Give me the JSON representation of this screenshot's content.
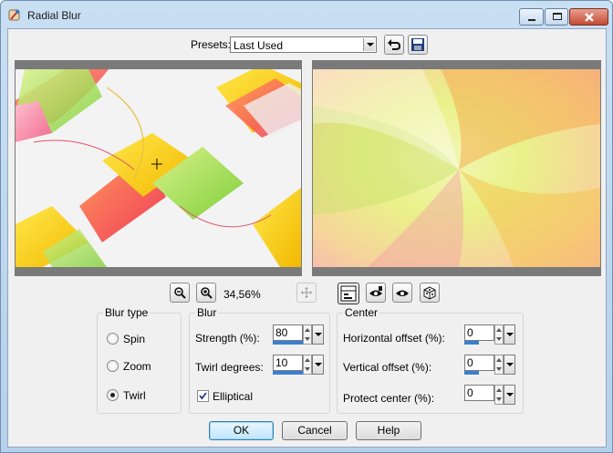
{
  "window": {
    "title": "Radial Blur"
  },
  "presets": {
    "label": "Presets:",
    "value": "Last Used"
  },
  "zoom": {
    "value": "34,56%"
  },
  "blur_type": {
    "title": "Blur type",
    "options": [
      {
        "label": "Spin",
        "checked": false
      },
      {
        "label": "Zoom",
        "checked": false
      },
      {
        "label": "Twirl",
        "checked": true
      }
    ]
  },
  "blur": {
    "title": "Blur",
    "strength_label": "Strength (%):",
    "strength_value": "80",
    "twirl_label": "Twirl degrees:",
    "twirl_value": "10",
    "elliptical_label": "Elliptical",
    "elliptical_checked": true
  },
  "center": {
    "title": "Center",
    "hoffset_label": "Horizontal offset (%):",
    "hoffset_value": "0",
    "voffset_label": "Vertical offset (%):",
    "voffset_value": "0",
    "protect_label": "Protect center (%):",
    "protect_value": "0"
  },
  "buttons": {
    "ok": "OK",
    "cancel": "Cancel",
    "help": "Help"
  }
}
